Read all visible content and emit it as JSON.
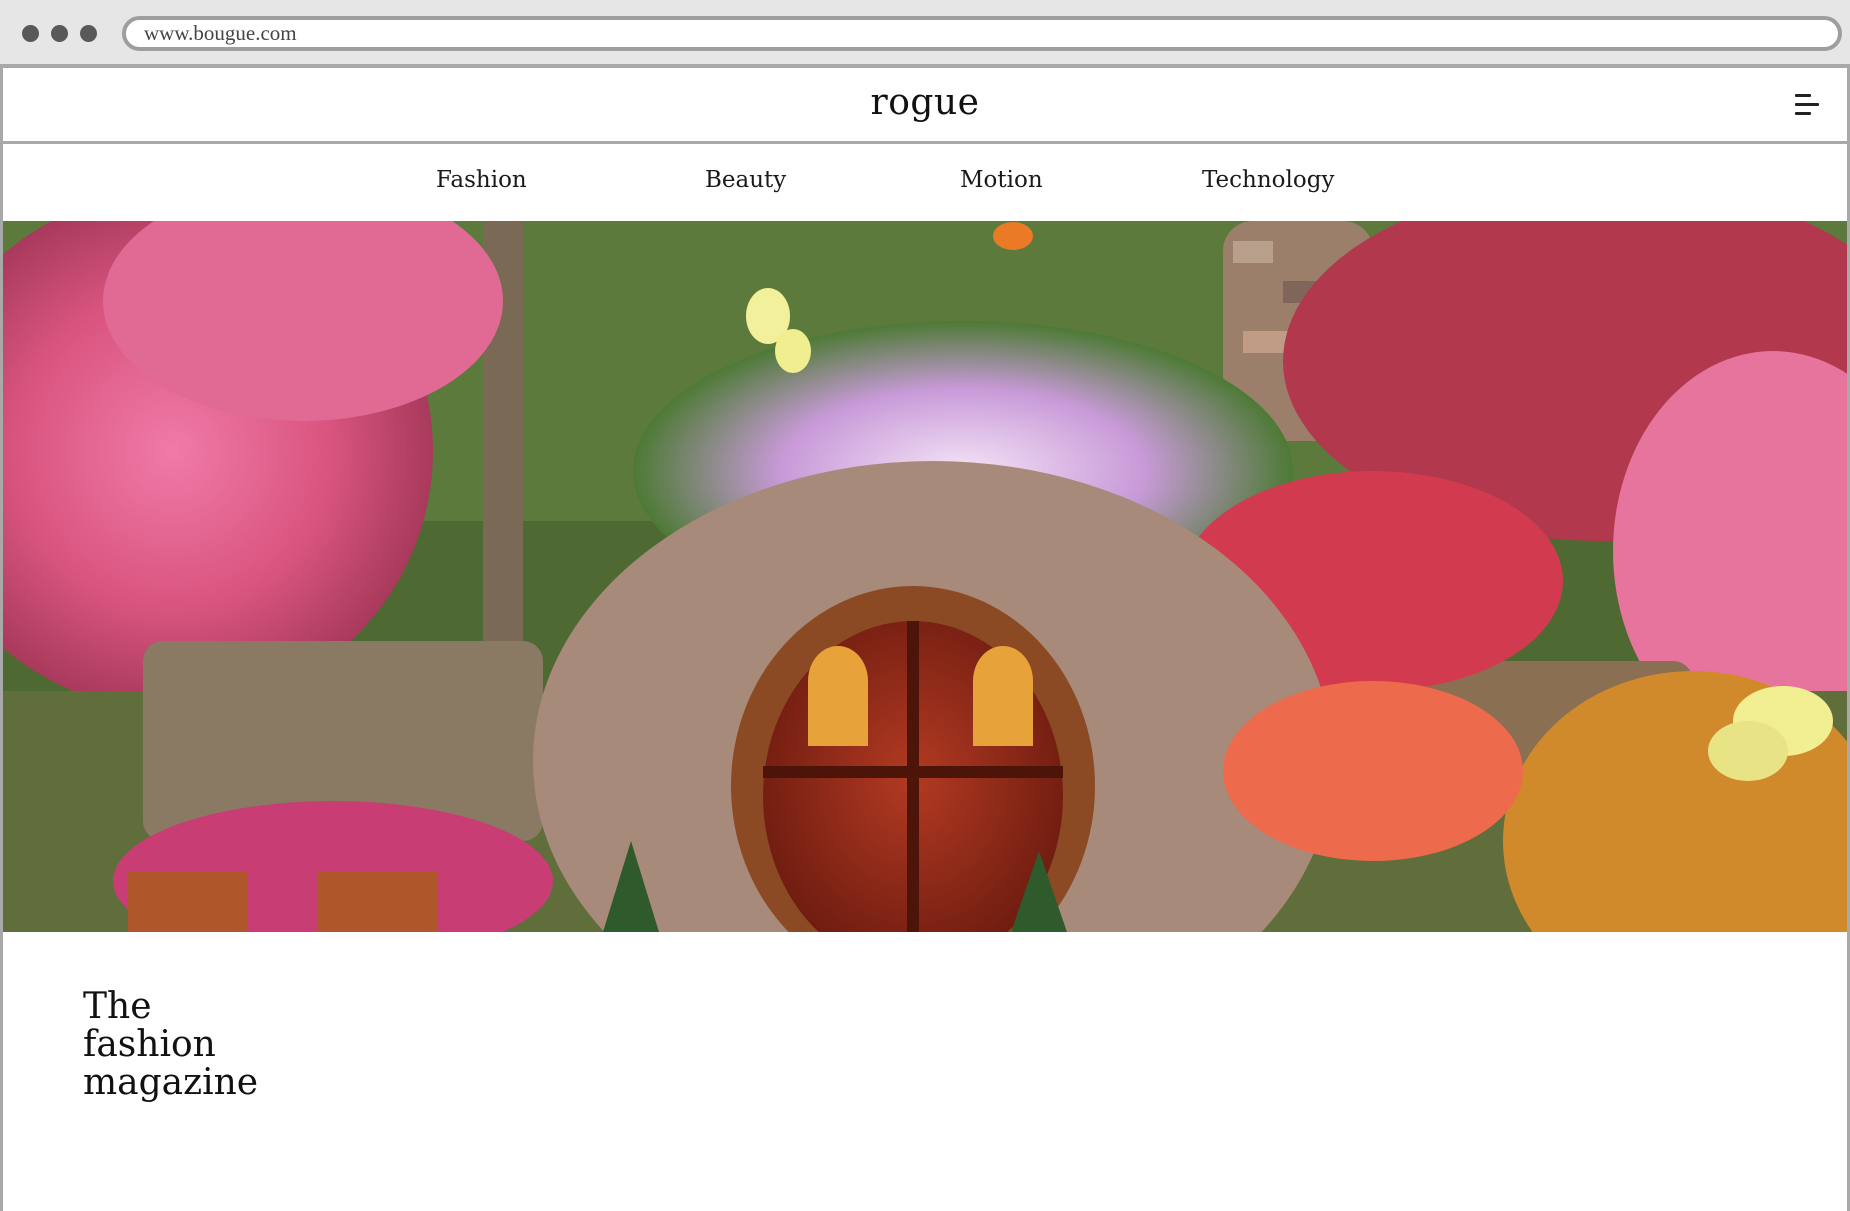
{
  "browser": {
    "url": "www.bougue.com"
  },
  "site": {
    "logo": "rogue"
  },
  "nav": {
    "items": [
      {
        "label": "Fashion"
      },
      {
        "label": "Beauty"
      },
      {
        "label": "Motion"
      },
      {
        "label": "Technology"
      }
    ]
  },
  "hero": {
    "image": "garden-hobbit-door-photo"
  },
  "tagline": {
    "lines": [
      "The",
      "fashion",
      "magazine"
    ]
  }
}
